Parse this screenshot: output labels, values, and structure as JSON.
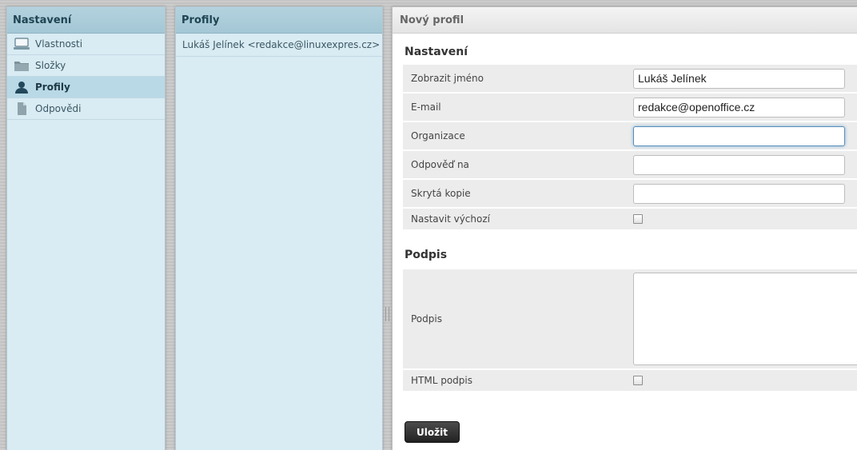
{
  "left_panel": {
    "title": "Nastavení",
    "items": [
      {
        "label": "Vlastnosti",
        "icon": "computer-icon"
      },
      {
        "label": "Složky",
        "icon": "folder-icon"
      },
      {
        "label": "Profily",
        "icon": "user-icon",
        "active": true
      },
      {
        "label": "Odpovědi",
        "icon": "document-icon"
      }
    ]
  },
  "middle_panel": {
    "title": "Profily",
    "items": [
      {
        "label": "Lukáš Jelínek <redakce@linuxexpres.cz>"
      }
    ]
  },
  "right_panel": {
    "title": "Nový profil",
    "settings_section": "Nastavení",
    "fields": {
      "display_name": {
        "label": "Zobrazit jméno",
        "value": "Lukáš Jelínek"
      },
      "email": {
        "label": "E-mail",
        "value": "redakce@openoffice.cz"
      },
      "organization": {
        "label": "Organizace",
        "value": ""
      },
      "reply_to": {
        "label": "Odpověď na",
        "value": ""
      },
      "bcc": {
        "label": "Skrytá kopie",
        "value": ""
      },
      "set_default": {
        "label": "Nastavit výchozí",
        "checked": false
      }
    },
    "signature_section": "Podpis",
    "signature": {
      "label": "Podpis",
      "value": ""
    },
    "html_signature": {
      "label": "HTML podpis",
      "checked": false
    },
    "save_label": "Uložit"
  },
  "colors": {
    "panel_bg": "#d9ebf3",
    "header_bg": "#a4c7d5",
    "active_item_bg": "#b9d9e6",
    "save_button_bg": "#2f2f2f"
  }
}
